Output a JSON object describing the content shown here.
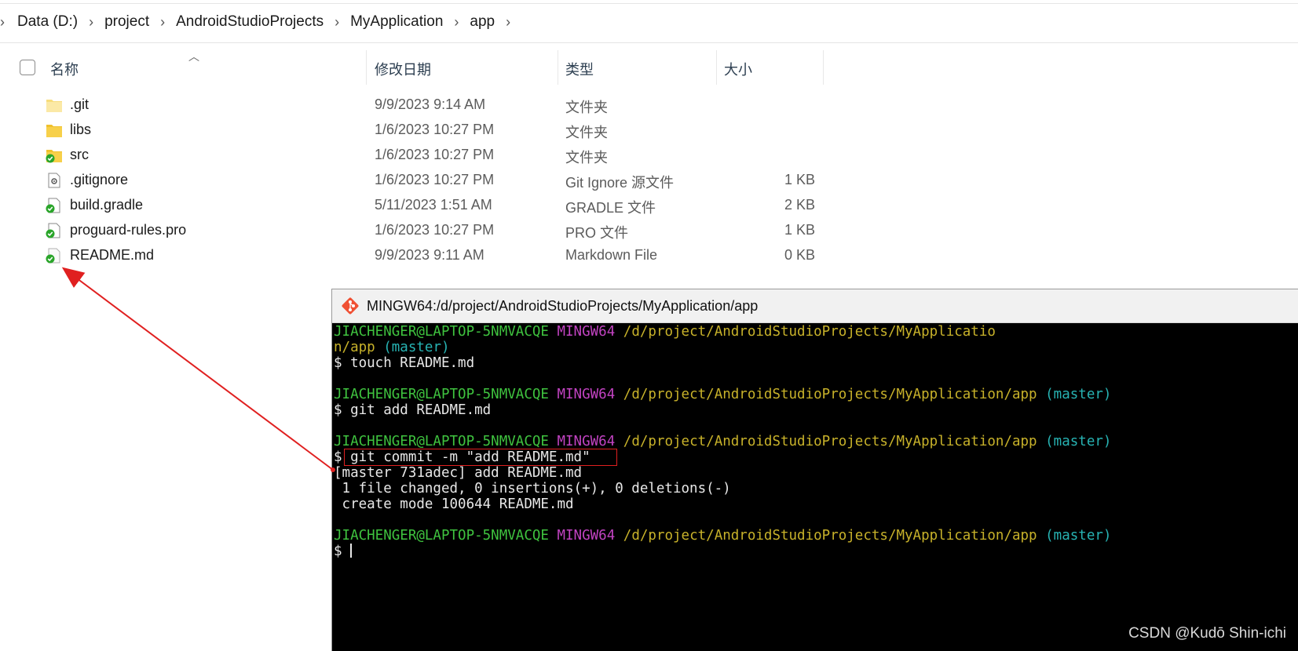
{
  "breadcrumb": [
    "Data (D:)",
    "project",
    "AndroidStudioProjects",
    "MyApplication",
    "app"
  ],
  "columns": {
    "name": "名称",
    "date": "修改日期",
    "type": "类型",
    "size": "大小"
  },
  "files": [
    {
      "name": ".git",
      "date": "9/9/2023 9:14 AM",
      "type": "文件夹",
      "size": "",
      "icon": "folder-icon"
    },
    {
      "name": "libs",
      "date": "1/6/2023 10:27 PM",
      "type": "文件夹",
      "size": "",
      "icon": "folder-icon"
    },
    {
      "name": "src",
      "date": "1/6/2023 10:27 PM",
      "type": "文件夹",
      "size": "",
      "icon": "folder-git-ok-icon"
    },
    {
      "name": ".gitignore",
      "date": "1/6/2023 10:27 PM",
      "type": "Git Ignore 源文件",
      "size": "1 KB",
      "icon": "settings-file-icon"
    },
    {
      "name": "build.gradle",
      "date": "5/11/2023 1:51 AM",
      "type": "GRADLE 文件",
      "size": "2 KB",
      "icon": "file-git-ok-icon"
    },
    {
      "name": "proguard-rules.pro",
      "date": "1/6/2023 10:27 PM",
      "type": "PRO 文件",
      "size": "1 KB",
      "icon": "file-git-ok-icon"
    },
    {
      "name": "README.md",
      "date": "9/9/2023 9:11 AM",
      "type": "Markdown File",
      "size": "0 KB",
      "icon": "file-git-ok-icon"
    }
  ],
  "terminal": {
    "title": "MINGW64:/d/project/AndroidStudioProjects/MyApplication/app",
    "user": "JIACHENGER@LAPTOP-5NMVACQE",
    "env": "MINGW64",
    "path_wrap_1": "/d/project/AndroidStudioProjects/MyApplicatio",
    "path_wrap_2": "n/app",
    "path": "/d/project/AndroidStudioProjects/MyApplication/app",
    "branch": "(master)",
    "cmd1": "$ touch README.md",
    "cmd2": "$ git add README.md",
    "cmd3_prompt": "$",
    "cmd3": " git commit -m \"add README.md\"",
    "out1": "[master 731adec] add README.md",
    "out2": " 1 file changed, 0 insertions(+), 0 deletions(-)",
    "out3": " create mode 100644 README.md",
    "prompt": "$ "
  },
  "watermark": "CSDN @Kudō Shin-ichi",
  "colors": {
    "prompt_user": "#3fc33f",
    "prompt_env": "#c243c2",
    "prompt_path": "#c8b22a",
    "prompt_branch": "#27b3b3",
    "annotation": "#e02020"
  }
}
